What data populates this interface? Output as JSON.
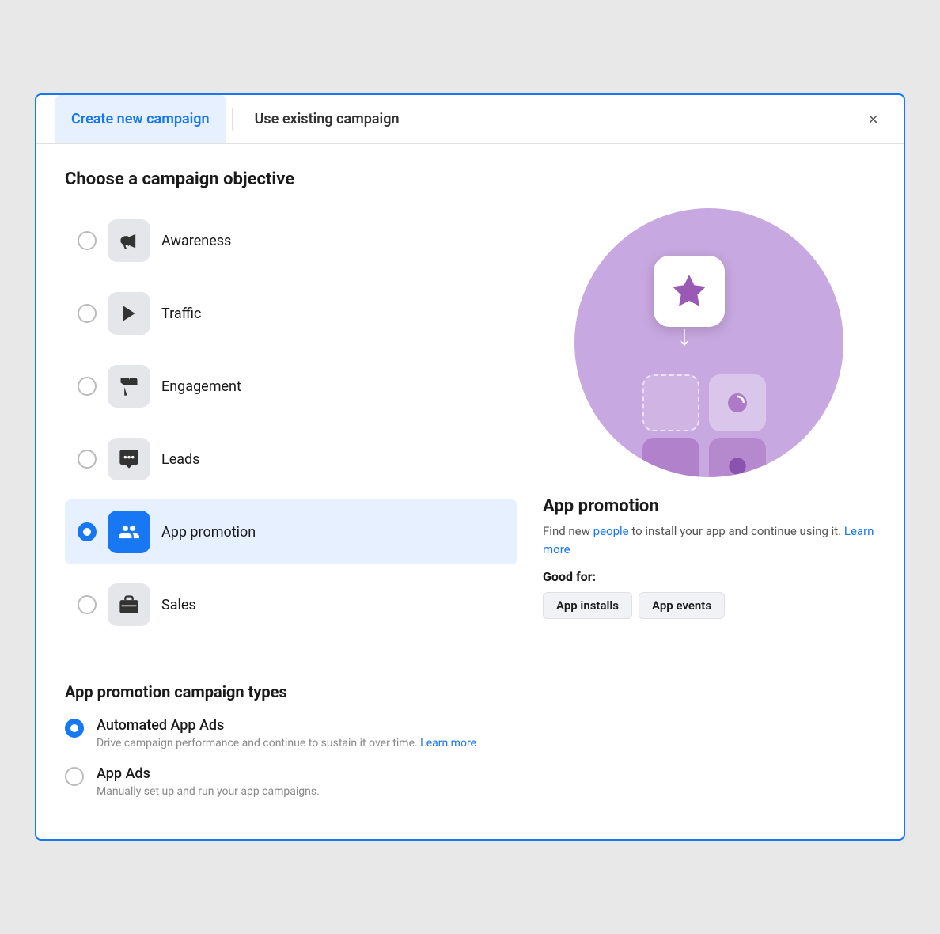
{
  "modal": {
    "border_color": "#1877f2"
  },
  "tabs": {
    "active": "Create new campaign",
    "inactive": "Use existing campaign"
  },
  "close_label": "×",
  "section_heading": "Choose a campaign objective",
  "objectives": [
    {
      "id": "awareness",
      "label": "Awareness",
      "icon": "📣",
      "selected": false
    },
    {
      "id": "traffic",
      "label": "Traffic",
      "icon": "▶",
      "selected": false
    },
    {
      "id": "engagement",
      "label": "Engagement",
      "icon": "👍",
      "selected": false
    },
    {
      "id": "leads",
      "label": "Leads",
      "icon": "💬",
      "selected": false
    },
    {
      "id": "app-promotion",
      "label": "App promotion",
      "icon": "👥",
      "selected": true
    },
    {
      "id": "sales",
      "label": "Sales",
      "icon": "🧳",
      "selected": false
    }
  ],
  "preview": {
    "title": "App promotion",
    "description_part1": "Find new ",
    "description_highlight": "people",
    "description_part2": " to install your app and continue using it.",
    "learn_more": "Learn more",
    "good_for_title": "Good for:",
    "tags": [
      "App installs",
      "App events"
    ]
  },
  "campaign_types": {
    "title": "App promotion campaign types",
    "types": [
      {
        "id": "automated",
        "name": "Automated App Ads",
        "description": "Drive campaign performance and continue to sustain it over time.",
        "learn_more": "Learn more",
        "selected": true
      },
      {
        "id": "app-ads",
        "name": "App Ads",
        "description": "Manually set up and run your app campaigns.",
        "learn_more": "",
        "selected": false
      }
    ]
  }
}
